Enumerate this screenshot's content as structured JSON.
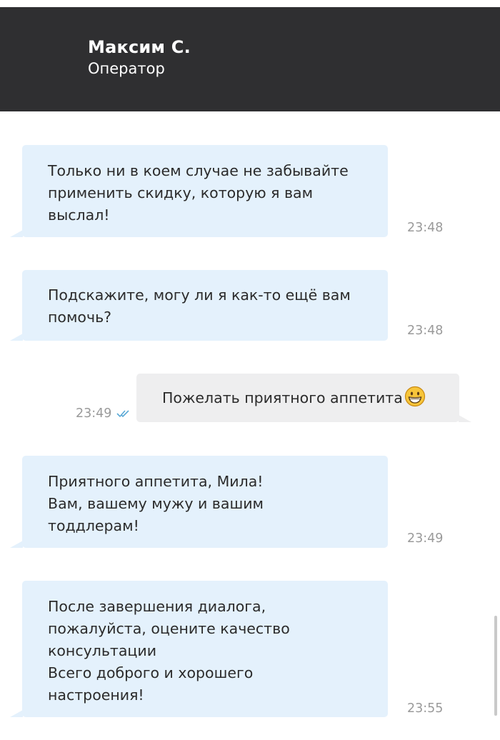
{
  "header": {
    "name": "Максим С.",
    "role": "Оператор"
  },
  "messages": [
    {
      "direction": "incoming",
      "text": "Только ни в коем случае не забывайте\nприменить скидку, которую я вам\nвыслал!",
      "time": "23:48"
    },
    {
      "direction": "incoming",
      "text": "Подскажите, могу ли я как-то ещё вам\nпомочь?",
      "time": "23:48"
    },
    {
      "direction": "outgoing",
      "text": "Пожелать приятного аппетита",
      "emoji": "grinning-face",
      "time": "23:49",
      "status": "read"
    },
    {
      "direction": "incoming",
      "text": "Приятного аппетита, Мила!\nВам, вашему мужу и вашим\nтоддлерам!",
      "time": "23:49"
    },
    {
      "direction": "incoming",
      "text": "После завершения диалога,\nпожалуйста, оцените качество\nконсультации\nВсего доброго и хорошего\nнастроения!",
      "time": "23:55"
    }
  ],
  "colors": {
    "header_bg": "#2f2f31",
    "incoming_bubble": "#e4f1fc",
    "outgoing_bubble": "#eeeeef",
    "read_check": "#5aa9d6"
  }
}
